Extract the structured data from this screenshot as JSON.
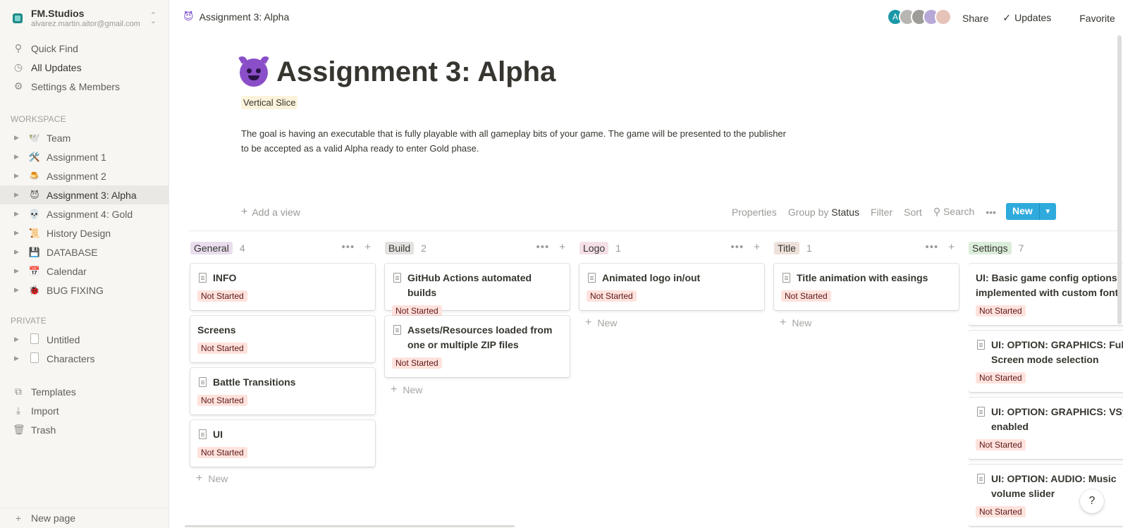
{
  "workspace": {
    "name": "FM.Studios",
    "email": "alvarez.martin.aitor@gmail.com"
  },
  "sidebar": {
    "quick_find": "Quick Find",
    "all_updates": "All Updates",
    "settings": "Settings & Members",
    "workspace_heading": "WORKSPACE",
    "pages": [
      {
        "emoji": "🕊️",
        "label": "Team"
      },
      {
        "emoji": "🛠️",
        "label": "Assignment 1"
      },
      {
        "emoji": "🍮",
        "label": "Assignment 2"
      },
      {
        "emoji": "😈",
        "label": "Assignment 3: Alpha"
      },
      {
        "emoji": "💀",
        "label": "Assignment 4: Gold"
      },
      {
        "emoji": "📜",
        "label": "History Design"
      },
      {
        "emoji": "💾",
        "label": "DATABASE"
      },
      {
        "emoji": "📅",
        "label": "Calendar"
      },
      {
        "emoji": "🐞",
        "label": "BUG FIXING"
      }
    ],
    "private_heading": "PRIVATE",
    "private_pages": [
      {
        "label": "Untitled"
      },
      {
        "label": "Characters"
      }
    ],
    "templates": "Templates",
    "import": "Import",
    "trash": "Trash",
    "new_page": "New page"
  },
  "topbar": {
    "breadcrumb": "Assignment 3: Alpha",
    "avatar_initial": "A",
    "share": "Share",
    "updates": "Updates",
    "favorite": "Favorite",
    "more": "•••"
  },
  "page": {
    "title": "Assignment 3: Alpha",
    "tag": "Vertical Slice",
    "description": "The goal is having an executable that is fully playable with all gameplay bits of your game. The game will be presented to the publisher to be accepted as a valid Alpha ready to enter Gold phase."
  },
  "board_toolbar": {
    "add_view": "Add a view",
    "properties": "Properties",
    "group_by_prefix": "Group by",
    "group_by_value": "Status",
    "filter": "Filter",
    "sort": "Sort",
    "search": "Search",
    "more": "•••",
    "new": "New"
  },
  "board": {
    "new_label": "New",
    "status_label": "Not Started",
    "columns": [
      {
        "name": "General",
        "count": "4",
        "color": "#e8deee",
        "cards": [
          {
            "title": "INFO",
            "doc": true
          },
          {
            "title": "Screens",
            "doc": false
          },
          {
            "title": "Battle Transitions",
            "doc": true
          },
          {
            "title": "UI",
            "doc": true
          }
        ]
      },
      {
        "name": "Build",
        "count": "2",
        "color": "#e3e2e0",
        "cards": [
          {
            "title": "GitHub Actions automated builds",
            "doc": true
          },
          {
            "title": "Assets/Resources loaded from one or multiple ZIP files",
            "doc": true
          }
        ]
      },
      {
        "name": "Logo",
        "count": "1",
        "color": "#f5e0e9",
        "cards": [
          {
            "title": "Animated logo in/out",
            "doc": true
          }
        ]
      },
      {
        "name": "Title",
        "count": "1",
        "color": "#eee0da",
        "cards": [
          {
            "title": "Title animation with easings",
            "doc": true
          }
        ]
      },
      {
        "name": "Settings",
        "count": "7",
        "color": "#dbeddb",
        "cards": [
          {
            "title": "UI: Basic game config options implemented with custom font",
            "doc": false
          },
          {
            "title": "UI: OPTION: GRAPHICS: Full Screen mode selection",
            "doc": true
          },
          {
            "title": "UI: OPTION: GRAPHICS: VSync enabled",
            "doc": true
          },
          {
            "title": "UI: OPTION: AUDIO: Music volume slider",
            "doc": true
          }
        ]
      }
    ]
  },
  "help": "?"
}
